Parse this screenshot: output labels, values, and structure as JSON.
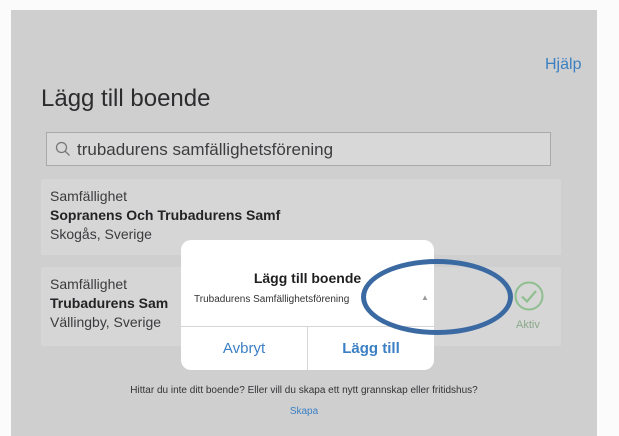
{
  "header": {
    "help_link": "Hjälp",
    "title": "Lägg till boende"
  },
  "search": {
    "value": "trubadurens samfällighetsförening",
    "icon": "search-icon"
  },
  "results": [
    {
      "type": "Samfällighet",
      "name": "Sopranens Och Trubadurens Samf",
      "location": "Skogås, Sverige"
    },
    {
      "type": "Samfällighet",
      "name": "Trubadurens Sam",
      "location": "Vällingby, Sverige",
      "status": "Aktiv",
      "status_icon": "check-circle-icon"
    }
  ],
  "dialog": {
    "title": "Lägg till boende",
    "input_value": "Trubadurens Samfällighetsförening",
    "cancel_label": "Avbryt",
    "confirm_label": "Lägg till"
  },
  "footer": {
    "prompt": "Hittar du inte ditt boende? Eller vill du skapa ett nytt grannskap eller fritidshus?",
    "create_link": "Skapa"
  },
  "colors": {
    "accent": "#3c80c2",
    "annotation": "#3b6aa3",
    "active_green": "#8aa98a"
  }
}
